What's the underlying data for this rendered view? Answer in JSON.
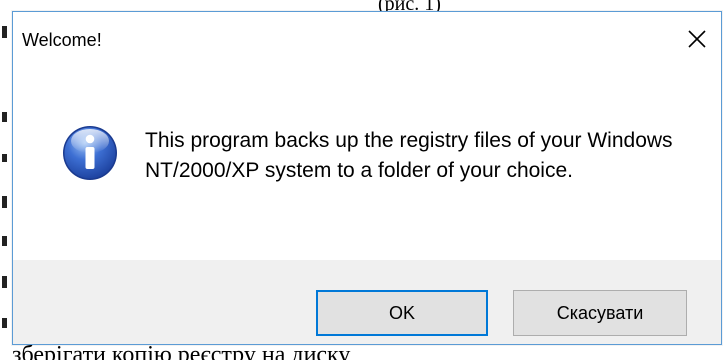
{
  "background": {
    "top_fragment": "(рис. 1)",
    "bottom_fragment": "зберігати копію реєстру на диску"
  },
  "dialog": {
    "title": "Welcome!",
    "message": "This program backs up the registry files of your Windows NT/2000/XP system to a folder of your choice.",
    "icon": "info-icon",
    "buttons": {
      "ok_label": "OK",
      "cancel_label": "Скасувати"
    }
  },
  "colors": {
    "window_border": "#5b9bd5",
    "footer_bg": "#f0f0f0",
    "button_bg": "#e1e1e1",
    "default_button_border": "#0078d7"
  }
}
